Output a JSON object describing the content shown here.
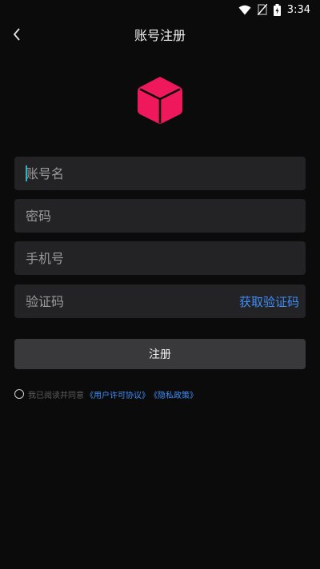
{
  "status_bar": {
    "time": "3:34"
  },
  "header": {
    "title": "账号注册"
  },
  "form": {
    "account_placeholder": "账号名",
    "password_placeholder": "密码",
    "phone_placeholder": "手机号",
    "code_placeholder": "验证码",
    "get_code_label": "获取验证码",
    "submit_label": "注册"
  },
  "agreement": {
    "prefix": "我已阅读并同意",
    "user_agreement": "《用户许可协议》",
    "privacy_policy": "《隐私政策》"
  },
  "colors": {
    "accent": "#3f8ef7",
    "logo": "#f0185c",
    "background": "#0b0b0c",
    "field": "#232325"
  }
}
